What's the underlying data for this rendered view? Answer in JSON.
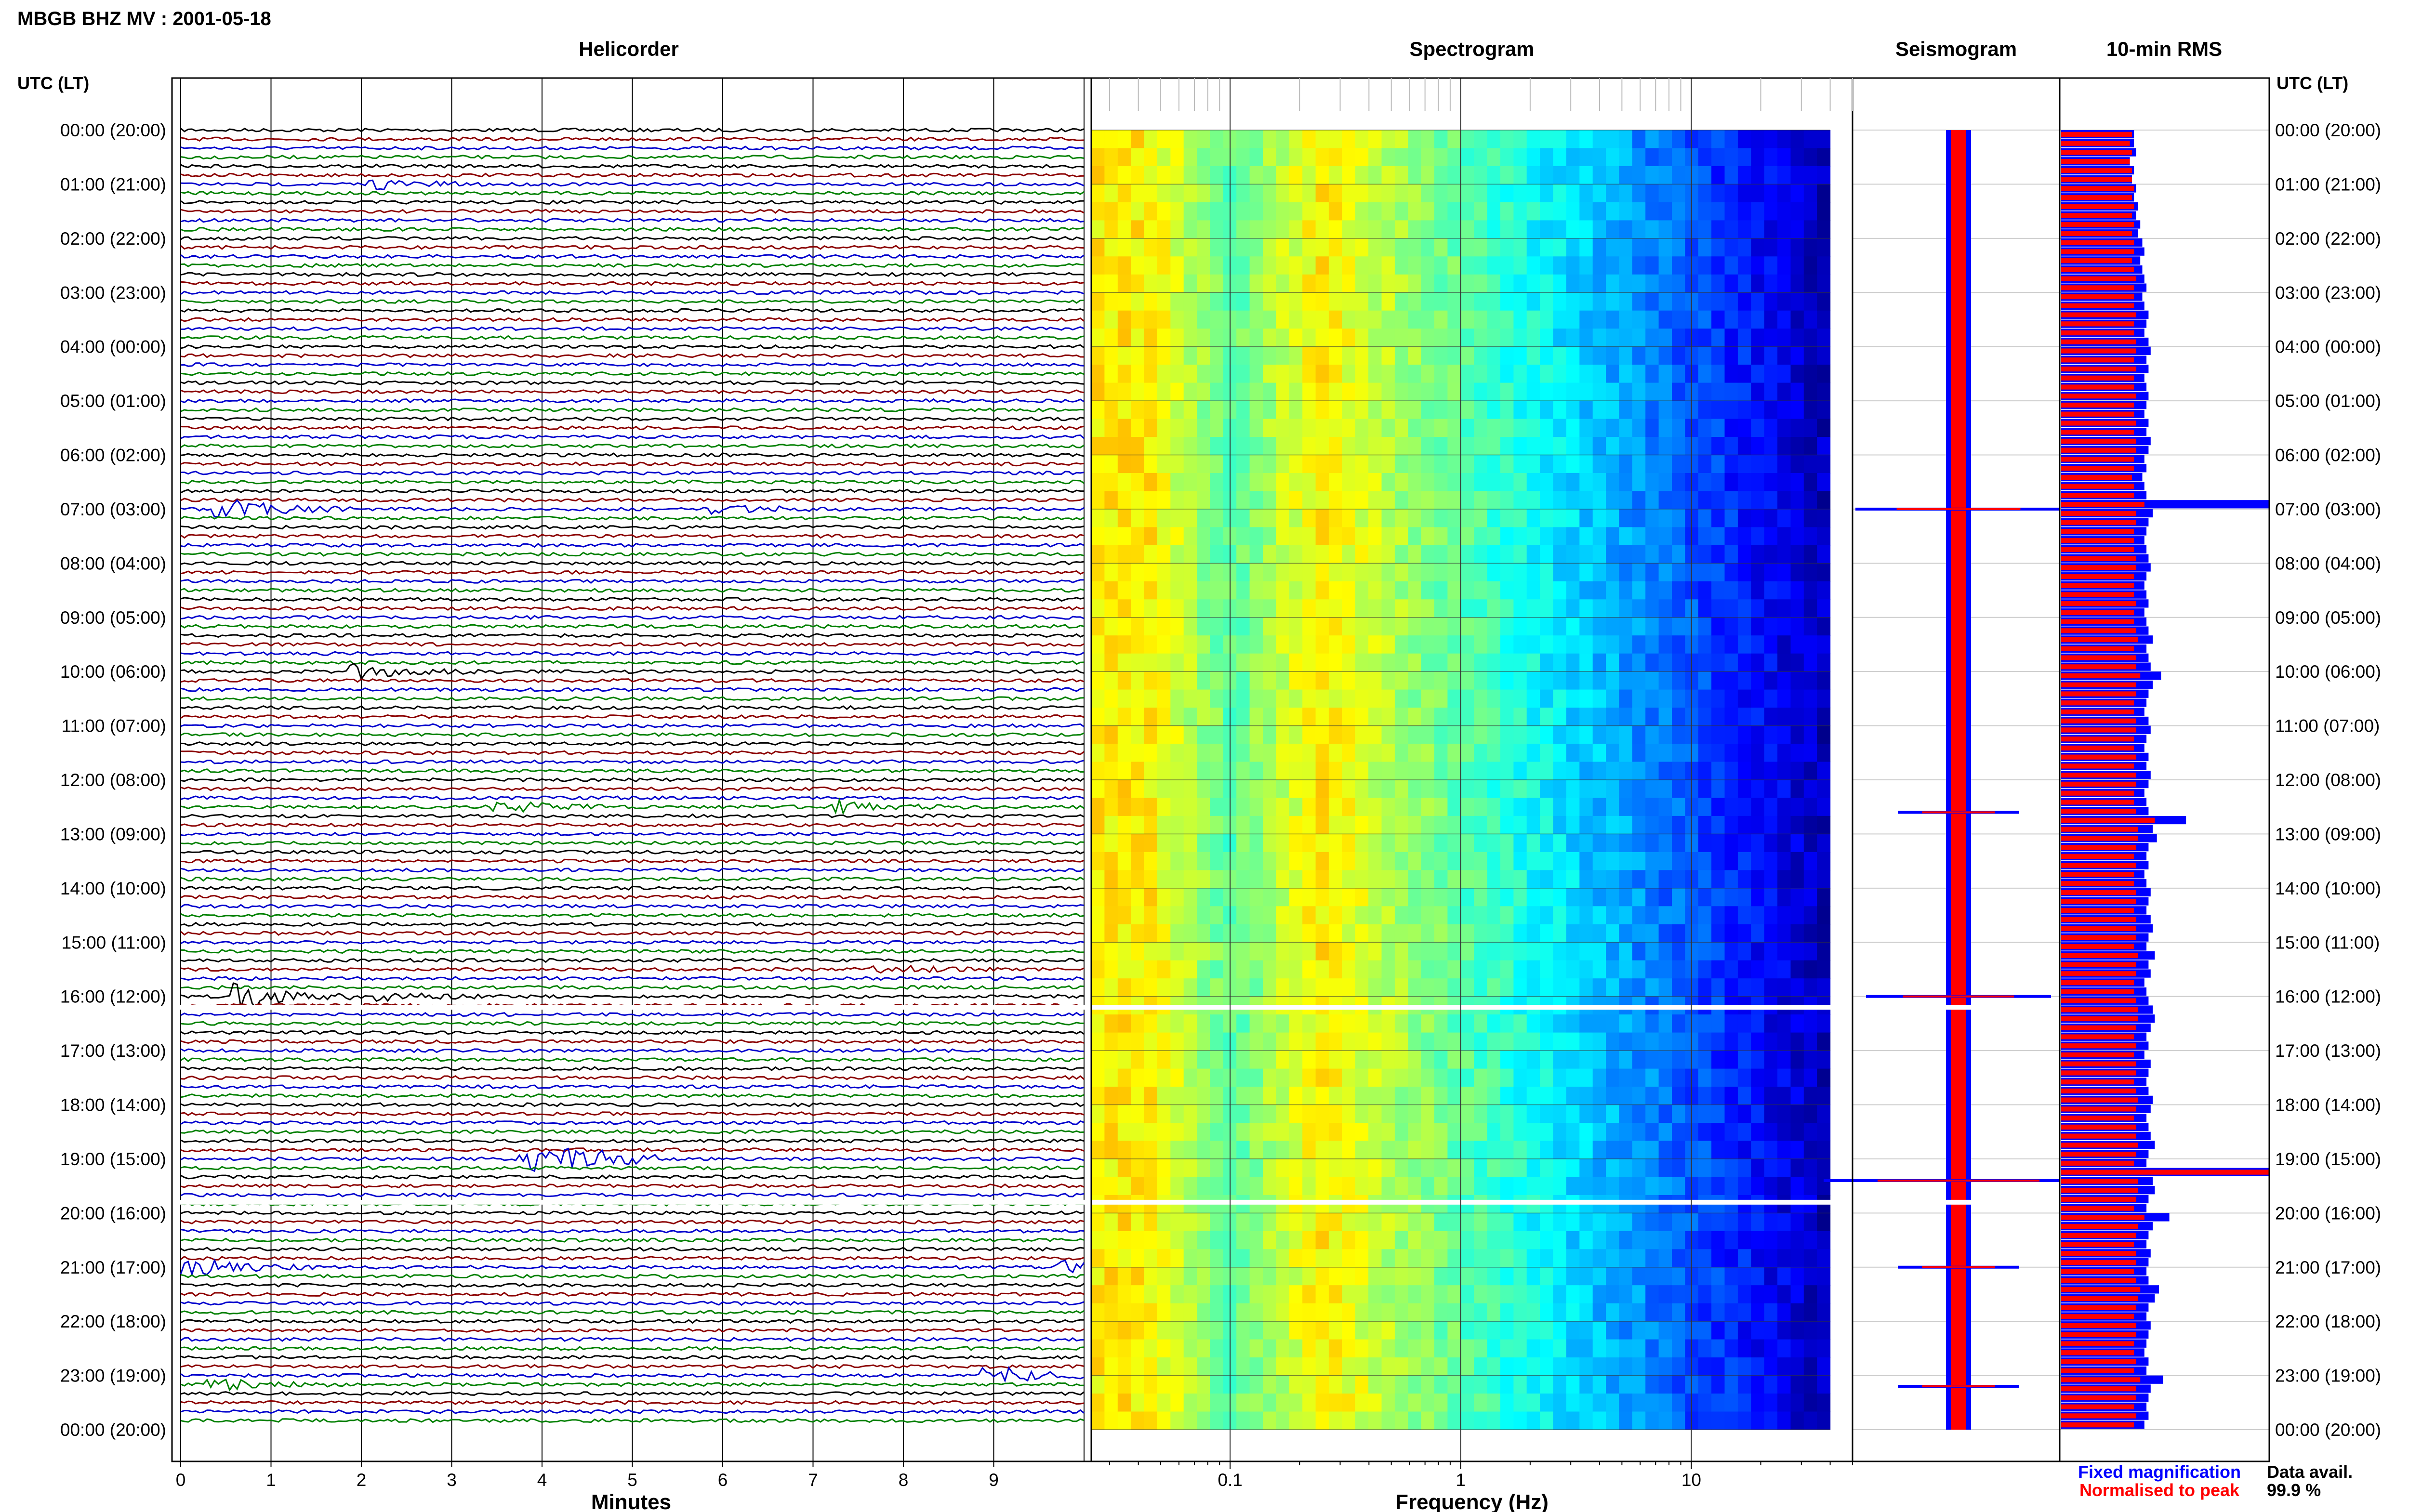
{
  "chart_data": {
    "type": "heatmap",
    "title": "MBGB BHZ MV : 2001-05-18",
    "time_axis_label": "UTC (LT)",
    "hour_labels": [
      "00:00 (20:00)",
      "01:00 (21:00)",
      "02:00 (22:00)",
      "03:00 (23:00)",
      "04:00 (00:00)",
      "05:00 (01:00)",
      "06:00 (02:00)",
      "07:00 (03:00)",
      "08:00 (04:00)",
      "09:00 (05:00)",
      "10:00 (06:00)",
      "11:00 (07:00)",
      "12:00 (08:00)",
      "13:00 (09:00)",
      "14:00 (10:00)",
      "15:00 (11:00)",
      "16:00 (12:00)",
      "17:00 (13:00)",
      "18:00 (14:00)",
      "19:00 (15:00)",
      "20:00 (16:00)",
      "21:00 (17:00)",
      "22:00 (18:00)",
      "23:00 (19:00)",
      "00:00 (20:00)"
    ],
    "panels": {
      "helicorder": {
        "title": "Helicorder",
        "xlabel": "Minutes",
        "x_ticks": [
          "0",
          "1",
          "2",
          "3",
          "4",
          "5",
          "6",
          "7",
          "8",
          "9"
        ],
        "xlim": [
          0,
          10
        ],
        "trace_colors": [
          "#000000",
          "#8b0000",
          "#0000cd",
          "#008000"
        ],
        "events": [
          {
            "hour": 1.0,
            "minute": 2.2,
            "amp": 0.4
          },
          {
            "hour": 7.0,
            "minute": 0.5,
            "amp": 1.0
          },
          {
            "hour": 7.0,
            "minute": 6.0,
            "amp": 0.4
          },
          {
            "hour": 10.0,
            "minute": 2.0,
            "amp": 0.6
          },
          {
            "hour": 12.5,
            "minute": 3.6,
            "amp": 0.5
          },
          {
            "hour": 12.5,
            "minute": 7.3,
            "amp": 0.5
          },
          {
            "hour": 15.5,
            "minute": 7.8,
            "amp": 0.3
          },
          {
            "hour": 16.0,
            "minute": 0.7,
            "amp": 1.2
          },
          {
            "hour": 16.0,
            "minute": 1.9,
            "amp": 0.6
          },
          {
            "hour": 19.0,
            "minute": 3.9,
            "amp": 2.8
          },
          {
            "hour": 21.0,
            "minute": 0.1,
            "amp": 0.8
          },
          {
            "hour": 21.0,
            "minute": 9.8,
            "amp": 0.6
          },
          {
            "hour": 23.2,
            "minute": 0.4,
            "amp": 0.5
          },
          {
            "hour": 23.0,
            "minute": 9.0,
            "amp": 0.8
          }
        ],
        "gaps_hours": [
          16.2,
          19.8
        ]
      },
      "spectrogram": {
        "title": "Spectrogram",
        "xlabel": "Frequency (Hz)",
        "x_scale": "log",
        "x_ticks": [
          "0.1",
          "1",
          "10"
        ],
        "xlim_hz": [
          0.025,
          50
        ],
        "data_max_hz": 40,
        "peak_hz": 0.25
      },
      "seismogram": {
        "title": "Seismogram",
        "spikes": [
          {
            "hour": 7.0,
            "amp": 0.7
          },
          {
            "hour": 12.6,
            "amp": 0.3
          },
          {
            "hour": 16.0,
            "amp": 0.6
          },
          {
            "hour": 19.4,
            "amp": 1.0
          },
          {
            "hour": 21.0,
            "amp": 0.3
          },
          {
            "hour": 23.2,
            "amp": 0.3
          }
        ]
      },
      "rms": {
        "title": "10-min RMS",
        "series": [
          {
            "name": "Fixed magnification",
            "color": "#0000ff"
          },
          {
            "name": "Normalised to peak",
            "color": "#ff0000"
          }
        ],
        "values_fixed": [
          0.35,
          0.35,
          0.36,
          0.33,
          0.35,
          0.34,
          0.36,
          0.35,
          0.37,
          0.36,
          0.38,
          0.37,
          0.39,
          0.4,
          0.38,
          0.39,
          0.4,
          0.41,
          0.39,
          0.4,
          0.42,
          0.41,
          0.4,
          0.42,
          0.43,
          0.41,
          0.42,
          0.4,
          0.41,
          0.42,
          0.41,
          0.4,
          0.42,
          0.41,
          0.43,
          0.42,
          0.4,
          0.41,
          0.39,
          0.4,
          0.41,
          1.0,
          0.44,
          0.42,
          0.41,
          0.4,
          0.41,
          0.42,
          0.43,
          0.41,
          0.4,
          0.41,
          0.42,
          0.4,
          0.41,
          0.42,
          0.44,
          0.41,
          0.42,
          0.43,
          0.48,
          0.44,
          0.42,
          0.41,
          0.4,
          0.42,
          0.43,
          0.41,
          0.4,
          0.42,
          0.41,
          0.43,
          0.42,
          0.4,
          0.41,
          0.42,
          0.6,
          0.44,
          0.46,
          0.42,
          0.41,
          0.42,
          0.4,
          0.41,
          0.43,
          0.42,
          0.41,
          0.43,
          0.44,
          0.42,
          0.41,
          0.45,
          0.42,
          0.43,
          0.4,
          0.41,
          0.42,
          0.44,
          0.45,
          0.43,
          0.41,
          0.42,
          0.4,
          0.43,
          0.42,
          0.41,
          0.42,
          0.44,
          0.43,
          0.41,
          0.42,
          0.43,
          0.45,
          0.42,
          0.41,
          1.0,
          0.44,
          0.45,
          0.42,
          0.41,
          0.52,
          0.44,
          0.42,
          0.41,
          0.43,
          0.42,
          0.41,
          0.42,
          0.47,
          0.45,
          0.42,
          0.41,
          0.43,
          0.42,
          0.41,
          0.4,
          0.42,
          0.41,
          0.49,
          0.43,
          0.42,
          0.41,
          0.42,
          0.4
        ],
        "values_normalised": [
          0.34,
          0.33,
          0.34,
          0.33,
          0.34,
          0.34,
          0.35,
          0.34,
          0.35,
          0.34,
          0.35,
          0.34,
          0.35,
          0.35,
          0.34,
          0.35,
          0.36,
          0.35,
          0.35,
          0.35,
          0.36,
          0.35,
          0.35,
          0.36,
          0.36,
          0.35,
          0.36,
          0.35,
          0.35,
          0.36,
          0.35,
          0.35,
          0.36,
          0.35,
          0.36,
          0.36,
          0.35,
          0.35,
          0.34,
          0.35,
          0.35,
          0.4,
          0.36,
          0.36,
          0.35,
          0.35,
          0.35,
          0.36,
          0.36,
          0.35,
          0.35,
          0.35,
          0.36,
          0.35,
          0.35,
          0.36,
          0.37,
          0.35,
          0.36,
          0.36,
          0.38,
          0.36,
          0.36,
          0.35,
          0.35,
          0.36,
          0.36,
          0.35,
          0.35,
          0.36,
          0.35,
          0.36,
          0.36,
          0.35,
          0.35,
          0.36,
          0.45,
          0.37,
          0.37,
          0.36,
          0.35,
          0.36,
          0.35,
          0.35,
          0.36,
          0.36,
          0.35,
          0.36,
          0.36,
          0.36,
          0.35,
          0.37,
          0.36,
          0.36,
          0.35,
          0.35,
          0.36,
          0.37,
          0.37,
          0.36,
          0.35,
          0.36,
          0.35,
          0.36,
          0.36,
          0.35,
          0.36,
          0.37,
          0.36,
          0.35,
          0.36,
          0.36,
          0.37,
          0.36,
          0.35,
          1.0,
          0.37,
          0.37,
          0.36,
          0.35,
          0.4,
          0.37,
          0.36,
          0.35,
          0.36,
          0.36,
          0.35,
          0.36,
          0.38,
          0.37,
          0.36,
          0.35,
          0.36,
          0.36,
          0.35,
          0.35,
          0.36,
          0.35,
          0.38,
          0.36,
          0.36,
          0.35,
          0.36,
          0.35
        ]
      }
    },
    "legend": {
      "fixed": "Fixed magnification",
      "normalised": "Normalised to peak"
    },
    "availability": {
      "label": "Data avail.",
      "value": "99.9 %"
    },
    "grid": true
  }
}
